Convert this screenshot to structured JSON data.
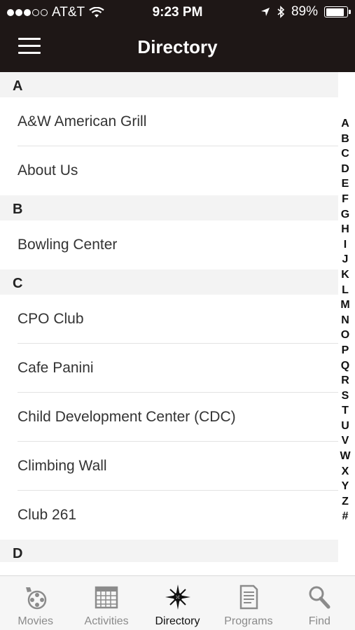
{
  "status_bar": {
    "carrier": "AT&T",
    "time": "9:23 PM",
    "battery": "89%",
    "battery_level": 0.89
  },
  "header": {
    "title": "Directory"
  },
  "sections": [
    {
      "letter": "A",
      "items": [
        "A&W American Grill",
        "About Us"
      ]
    },
    {
      "letter": "B",
      "items": [
        "Bowling Center"
      ]
    },
    {
      "letter": "C",
      "items": [
        "CPO Club",
        "Cafe Panini",
        "Child Development Center (CDC)",
        "Climbing Wall",
        "Club 261"
      ]
    },
    {
      "letter": "D",
      "items": []
    }
  ],
  "index_letters": [
    "A",
    "B",
    "C",
    "D",
    "E",
    "F",
    "G",
    "H",
    "I",
    "J",
    "K",
    "L",
    "M",
    "N",
    "O",
    "P",
    "Q",
    "R",
    "S",
    "T",
    "U",
    "V",
    "W",
    "X",
    "Y",
    "Z",
    "#"
  ],
  "tabs": [
    {
      "label": "Movies",
      "icon": "film-reel-icon",
      "active": false
    },
    {
      "label": "Activities",
      "icon": "calendar-icon",
      "active": false
    },
    {
      "label": "Directory",
      "icon": "compass-star-icon",
      "active": true
    },
    {
      "label": "Programs",
      "icon": "document-icon",
      "active": false
    },
    {
      "label": "Find",
      "icon": "magnifier-icon",
      "active": false
    }
  ],
  "colors": {
    "header_bg": "#1e1716",
    "section_bg": "#f3f3f3",
    "tab_inactive": "#8b8b8b",
    "tab_active": "#111111"
  }
}
